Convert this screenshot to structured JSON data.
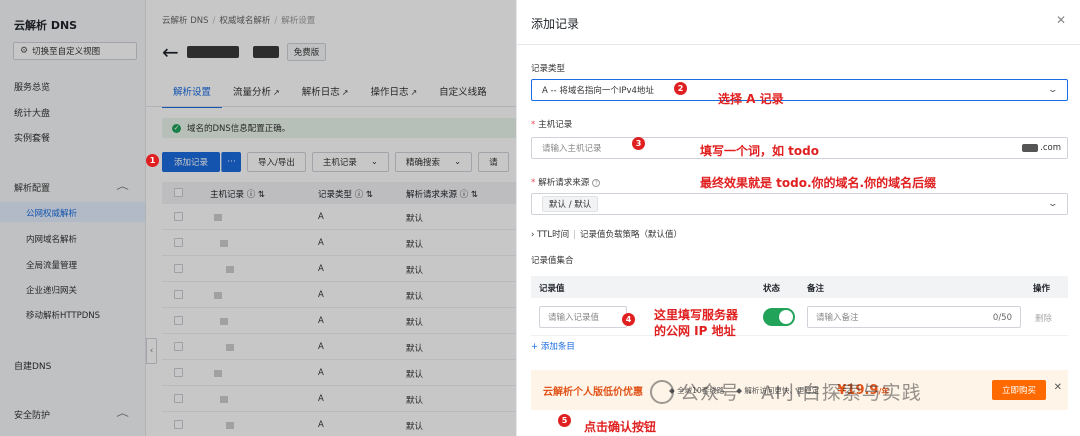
{
  "sidebar": {
    "title": "云解析 DNS",
    "switch_label": "切换至自定义视图",
    "items": [
      "服务总览",
      "统计大盘",
      "实例套餐"
    ],
    "group_config": "解析配置",
    "sub_items": [
      "公网权威解析",
      "内网域名解析",
      "全局流量管理",
      "企业递归网关",
      "移动解析HTTPDNS"
    ],
    "self_dns": "自建DNS",
    "security": "安全防护"
  },
  "main": {
    "breadcrumb": [
      "云解析 DNS",
      "权威域名解析",
      "解析设置"
    ],
    "free_badge": "免费版",
    "tabs": [
      "解析设置",
      "流量分析",
      "解析日志",
      "操作日志",
      "自定义线路"
    ],
    "alert": "域名的DNS信息配置正确。",
    "toolbar": {
      "add": "添加记录",
      "more": "···",
      "import": "导入/导出",
      "host": "主机记录",
      "search": "精确搜索",
      "extra": "请"
    },
    "table_headers": [
      "主机记录",
      "记录类型",
      "解析请求来源"
    ],
    "rows": [
      {
        "type": "A",
        "source": "默认"
      },
      {
        "type": "A",
        "source": "默认"
      },
      {
        "type": "A",
        "source": "默认"
      },
      {
        "type": "A",
        "source": "默认"
      },
      {
        "type": "A",
        "source": "默认"
      },
      {
        "type": "A",
        "source": "默认"
      },
      {
        "type": "A",
        "source": "默认"
      },
      {
        "type": "A",
        "source": "默认"
      },
      {
        "type": "A",
        "source": "默认"
      }
    ]
  },
  "drawer": {
    "title": "添加记录",
    "record_type_label": "记录类型",
    "record_type_value": "A -- 将域名指向一个IPv4地址",
    "host_label": "主机记录",
    "host_placeholder": "请输入主机记录",
    "host_suffix": ".com",
    "source_label": "解析请求来源",
    "source_value": "默认 / 默认",
    "ttl_text": "TTL时间",
    "ttl_text2": "记录值负载策略（默认值）",
    "values_label": "记录值集合",
    "headers": {
      "value": "记录值",
      "status": "状态",
      "remark": "备注",
      "action": "操作"
    },
    "value_placeholder": "请输入记录值",
    "remark_placeholder": "请输入备注",
    "counter": "0/50",
    "delete": "删除",
    "add_entry": "+ 添加条目",
    "promo": {
      "title": "云解析个人版低价优惠",
      "feat1": "全域10套线路",
      "feat2": "解析访问更快、更稳定",
      "price": "19.9",
      "unit": "/年",
      "button": "立即购买"
    }
  },
  "annotations": {
    "n1": "1",
    "n2": "2",
    "n3": "3",
    "n4": "4",
    "n5": "5",
    "note2": "选择 A 记录",
    "note3": "填写一个词，如 todo",
    "note3b": "最终效果就是 todo.你的域名.你的域名后缀",
    "note4a": "这里填写服务器",
    "note4b": "的公网 IP 地址",
    "note5": "点击确认按钮"
  },
  "watermark": "公众号 · AI小白探索与实践",
  "colors": {
    "primary": "#1a6ce0",
    "annotation": "#e02020",
    "success": "#22a35a",
    "promo": "#ff6a00"
  }
}
